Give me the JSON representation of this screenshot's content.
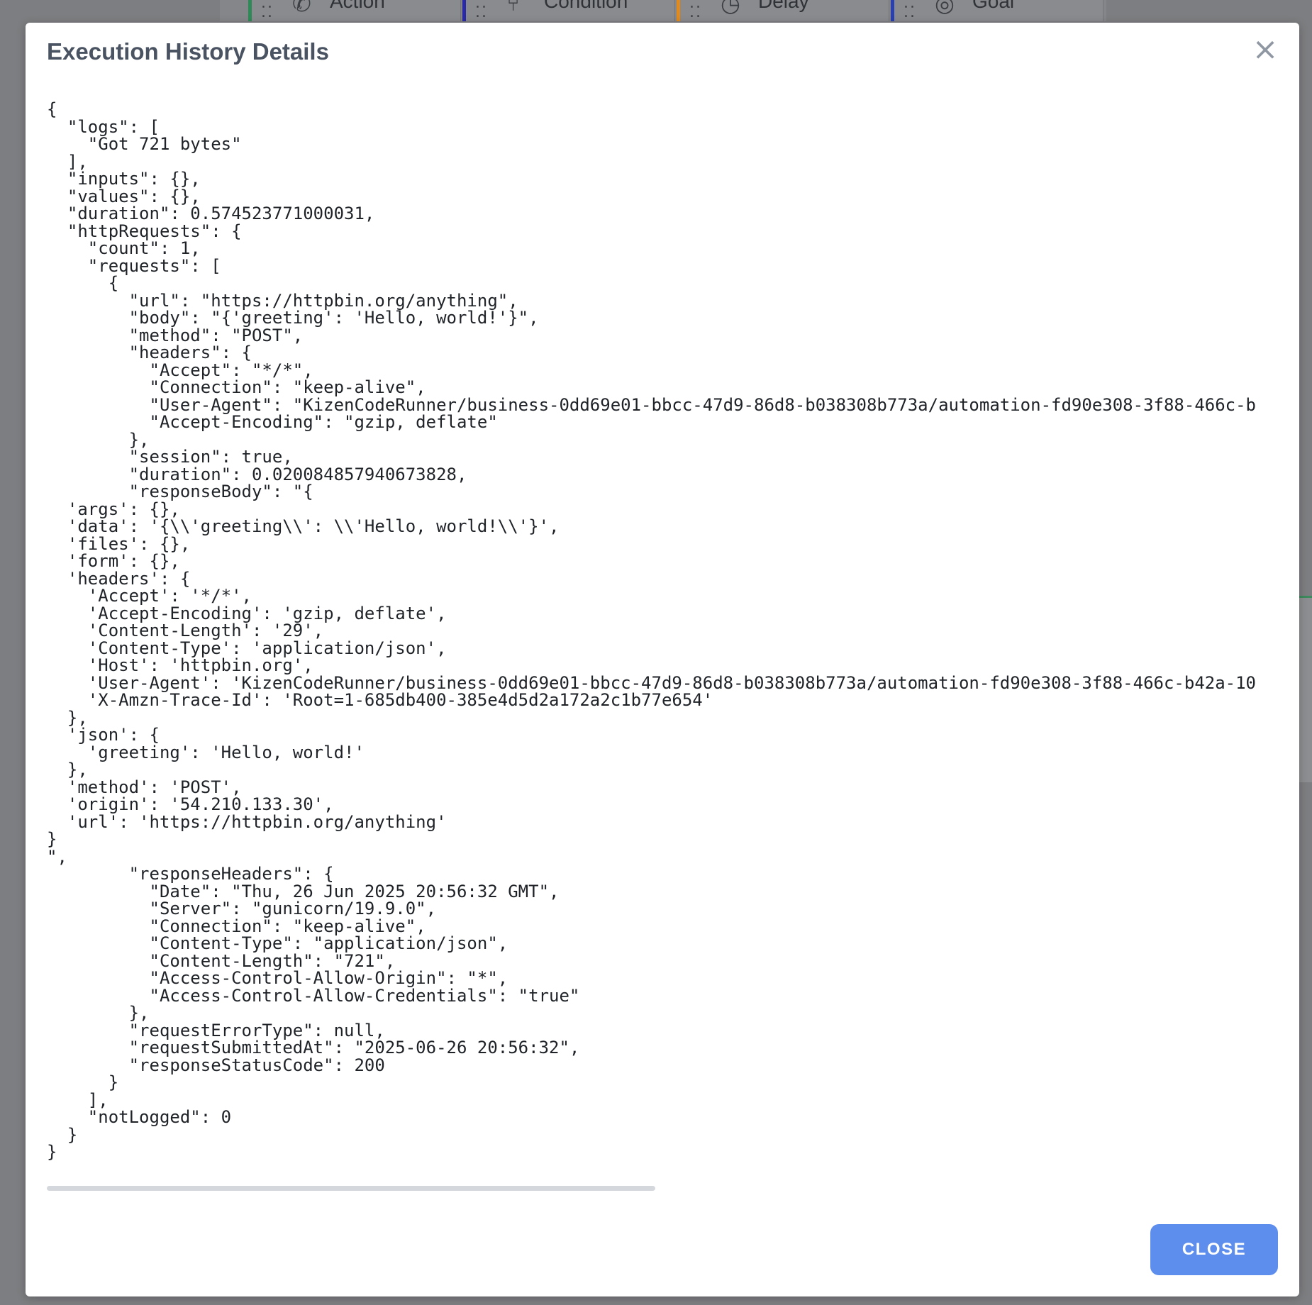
{
  "background": {
    "tabs": [
      {
        "label": "Action",
        "icon": "megaphone-icon",
        "color": "#2e8b57"
      },
      {
        "label": "Condition",
        "icon": "branch-icon",
        "color": "#2a2aa8"
      },
      {
        "label": "Delay",
        "icon": "clock-icon",
        "color": "#e08a1e"
      },
      {
        "label": "Goal",
        "icon": "target-icon",
        "color": "#2a3fb0"
      }
    ]
  },
  "modal": {
    "title": "Execution History Details",
    "close_icon": "close-icon",
    "close_label": "CLOSE",
    "accent": "#5d8eed",
    "lines": [
      "{",
      "  \"logs\": [",
      "    \"Got 721 bytes\"",
      "  ],",
      "  \"inputs\": {},",
      "  \"values\": {},",
      "  \"duration\": 0.574523771000031,",
      "  \"httpRequests\": {",
      "    \"count\": 1,",
      "    \"requests\": [",
      "      {",
      "        \"url\": \"https://httpbin.org/anything\",",
      "        \"body\": \"{'greeting': 'Hello, world!'}\",",
      "        \"method\": \"POST\",",
      "        \"headers\": {",
      "          \"Accept\": \"*/*\",",
      "          \"Connection\": \"keep-alive\",",
      "          \"User-Agent\": \"KizenCodeRunner/business-0dd69e01-bbcc-47d9-86d8-b038308b773a/automation-fd90e308-3f88-466c-b",
      "          \"Accept-Encoding\": \"gzip, deflate\"",
      "        },",
      "        \"session\": true,",
      "        \"duration\": 0.020084857940673828,",
      "        \"responseBody\": \"{",
      "  'args': {},",
      "  'data': '{\\\\'greeting\\\\': \\\\'Hello, world!\\\\'}',",
      "  'files': {},",
      "  'form': {},",
      "  'headers': {",
      "    'Accept': '*/*',",
      "    'Accept-Encoding': 'gzip, deflate',",
      "    'Content-Length': '29',",
      "    'Content-Type': 'application/json',",
      "    'Host': 'httpbin.org',",
      "    'User-Agent': 'KizenCodeRunner/business-0dd69e01-bbcc-47d9-86d8-b038308b773a/automation-fd90e308-3f88-466c-b42a-10",
      "    'X-Amzn-Trace-Id': 'Root=1-685db400-385e4d5d2a172a2c1b77e654'",
      "  },",
      "  'json': {",
      "    'greeting': 'Hello, world!'",
      "  },",
      "  'method': 'POST',",
      "  'origin': '54.210.133.30',",
      "  'url': 'https://httpbin.org/anything'",
      "}",
      "\",",
      "        \"responseHeaders\": {",
      "          \"Date\": \"Thu, 26 Jun 2025 20:56:32 GMT\",",
      "          \"Server\": \"gunicorn/19.9.0\",",
      "          \"Connection\": \"keep-alive\",",
      "          \"Content-Type\": \"application/json\",",
      "          \"Content-Length\": \"721\",",
      "          \"Access-Control-Allow-Origin\": \"*\",",
      "          \"Access-Control-Allow-Credentials\": \"true\"",
      "        },",
      "        \"requestErrorType\": null,",
      "        \"requestSubmittedAt\": \"2025-06-26 20:56:32\",",
      "        \"responseStatusCode\": 200",
      "      }",
      "    ],",
      "    \"notLogged\": 0",
      "  }",
      "}"
    ]
  }
}
